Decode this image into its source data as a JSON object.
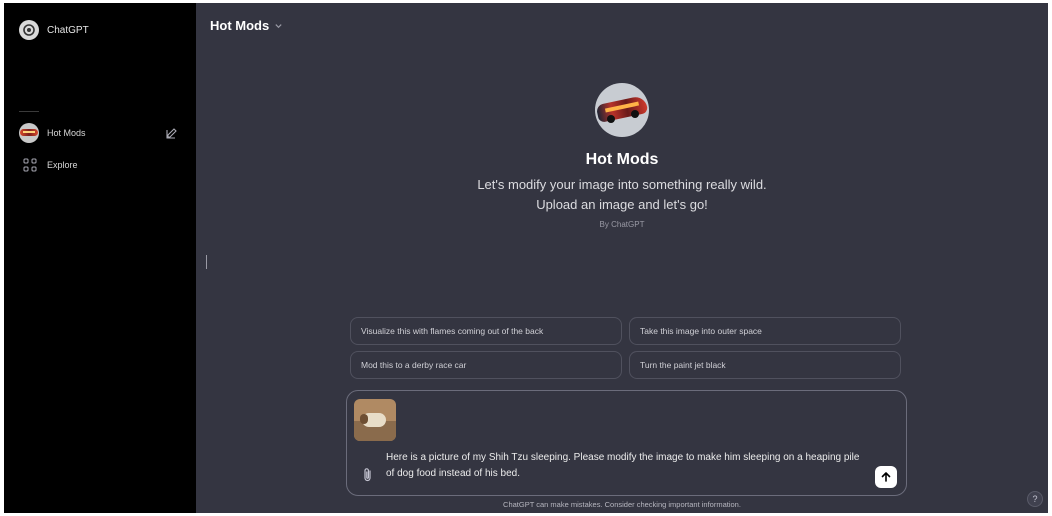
{
  "sidebar": {
    "brand": "ChatGPT",
    "items": [
      {
        "label": "Hot Mods",
        "icon": "gpt-avatar"
      },
      {
        "label": "Explore",
        "icon": "grid-icon"
      }
    ]
  },
  "header": {
    "title": "Hot Mods"
  },
  "gpt": {
    "name": "Hot Mods",
    "description_line1": "Let's modify your image into something really wild.",
    "description_line2": "Upload an image and let's go!",
    "author": "By ChatGPT"
  },
  "suggestions": [
    "Visualize this with flames coming out of the back",
    "Take this image into outer space",
    "Mod this to a derby race car",
    "Turn the paint jet black"
  ],
  "composer": {
    "message": "Here is a picture of my Shih Tzu sleeping. Please modify the image to make him sleeping on a heaping pile of dog food instead of his bed."
  },
  "footer": {
    "disclaimer": "ChatGPT can make mistakes. Consider checking important information."
  },
  "help": {
    "label": "?"
  },
  "colors": {
    "main_bg": "#343541",
    "sidebar_bg": "#000000",
    "border": "#50515e",
    "send_bg": "#ffffff"
  }
}
